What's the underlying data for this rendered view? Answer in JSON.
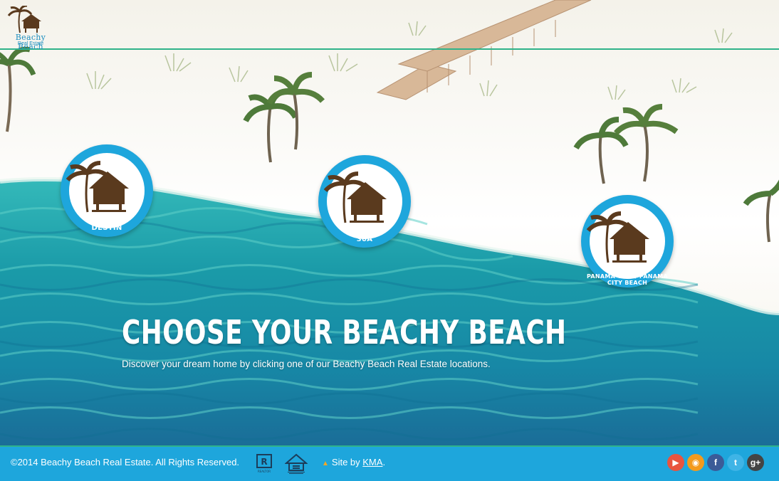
{
  "brand": {
    "name_line1": "Beachy Beach",
    "name_line2": "Real Estate"
  },
  "locations": [
    {
      "label": "DESTIN"
    },
    {
      "label": "30A"
    },
    {
      "label": "PANAMA CITY / PANAMA CITY BEACH"
    }
  ],
  "hero": {
    "headline": "CHOOSE YOUR BEACHY BEACH",
    "subline": "Discover your dream home by clicking one of our Beachy Beach Real Estate locations."
  },
  "footer": {
    "copyright": "©2014 Beachy Beach Real Estate. All Rights Reserved.",
    "site_by_prefix": "Site by ",
    "site_by_link": "KMA",
    "site_by_suffix": ".",
    "realtor_label": "REALTOR",
    "social": [
      {
        "icon": "youtube-icon",
        "glyph": "▶",
        "color": "#e8543f"
      },
      {
        "icon": "rss-icon",
        "glyph": "◉",
        "color": "#f39a1d"
      },
      {
        "icon": "facebook-icon",
        "glyph": "f",
        "color": "#3b5b98"
      },
      {
        "icon": "twitter-icon",
        "glyph": "t",
        "color": "#3fb4e6"
      },
      {
        "icon": "googleplus-icon",
        "glyph": "g+",
        "color": "#444444"
      }
    ]
  },
  "colors": {
    "accent": "#1ea6dc",
    "line": "#2fb38a",
    "hut": "#5a3a1e",
    "sea": "#1f9fb0"
  }
}
